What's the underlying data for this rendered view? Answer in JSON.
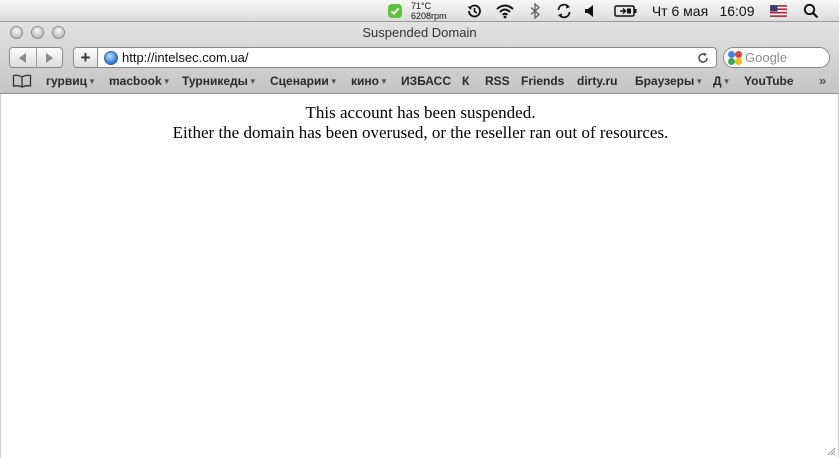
{
  "menubar": {
    "temperature": "71°C",
    "fan": "6208rpm",
    "date": "Чт 6 мая",
    "time": "16:09",
    "icons": [
      "app-status-icon",
      "time-machine-icon",
      "wifi-icon",
      "bluetooth-icon",
      "sync-icon",
      "volume-icon",
      "battery-icon",
      "us-flag-icon",
      "spotlight-icon"
    ]
  },
  "window": {
    "title": "Suspended Domain",
    "url": "http://intelsec.com.ua/",
    "search_placeholder": "Google"
  },
  "bookmarks": [
    {
      "label": "гурвиц",
      "menu": true
    },
    {
      "label": "macbook",
      "menu": true
    },
    {
      "label": "Турникеды",
      "menu": true
    },
    {
      "label": "Сценарии",
      "menu": true
    },
    {
      "label": "кино",
      "menu": true
    },
    {
      "label": "ИЗБАСС",
      "menu": false
    },
    {
      "label": "К",
      "menu": false
    },
    {
      "label": "RSS",
      "menu": false
    },
    {
      "label": "Friends",
      "menu": false
    },
    {
      "label": "dirty.ru",
      "menu": false
    },
    {
      "label": "Браузеры",
      "menu": true
    },
    {
      "label": "Д",
      "menu": true
    },
    {
      "label": "YouTube",
      "menu": false
    }
  ],
  "page": {
    "line1": "This account has been suspended.",
    "line2": "Either the domain has been overused, or the reseller ran out of resources."
  },
  "colors": {
    "app_status_green": "#5cc13c",
    "flag_blue": "#3c3b6e",
    "flag_red": "#b22234"
  }
}
